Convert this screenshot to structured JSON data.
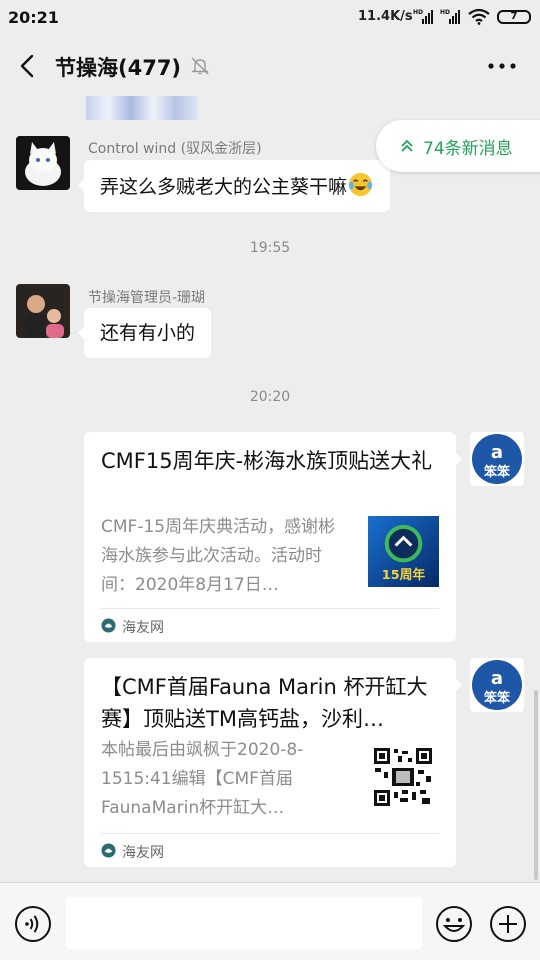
{
  "status_bar": {
    "time": "20:21",
    "net_speed": "11.4K/s",
    "battery": "7"
  },
  "header": {
    "title": "节操海(477)",
    "back_icon": "chevron-left-icon",
    "mute_icon": "bell-off-icon",
    "more_icon": "more-dots-icon"
  },
  "new_messages": {
    "label": "74条新消息",
    "color": "#26a35a"
  },
  "messages": [
    {
      "sender": "Control wind (驭风金浙层)",
      "text": "弄这么多贼老大的公主葵干嘛",
      "emoji": "tears-of-joy-emoji"
    },
    {
      "sender": "节操海管理员-珊瑚",
      "text": "还有有小的"
    }
  ],
  "timestamps": [
    "19:55",
    "20:20"
  ],
  "cards": [
    {
      "title": "CMF15周年庆-彬海水族顶贴送大礼",
      "desc": "CMF-15周年庆典活动，感谢彬海水族参与此次活动。活动时间：2020年8月17日…",
      "thumb_text": "15周年",
      "source": "海友网"
    },
    {
      "title": "【CMF首届Fauna Marin 杯开缸大赛】顶贴送TM高钙盐，沙利…",
      "desc": "本帖最后由飒枫于2020-8-1515:41编辑【CMF首届FaunaMarin杯开缸大…",
      "source": "海友网"
    }
  ],
  "input": {
    "placeholder": ""
  },
  "colors": {
    "background": "#ededed",
    "bubble": "#ffffff",
    "accent": "#26a35a"
  }
}
